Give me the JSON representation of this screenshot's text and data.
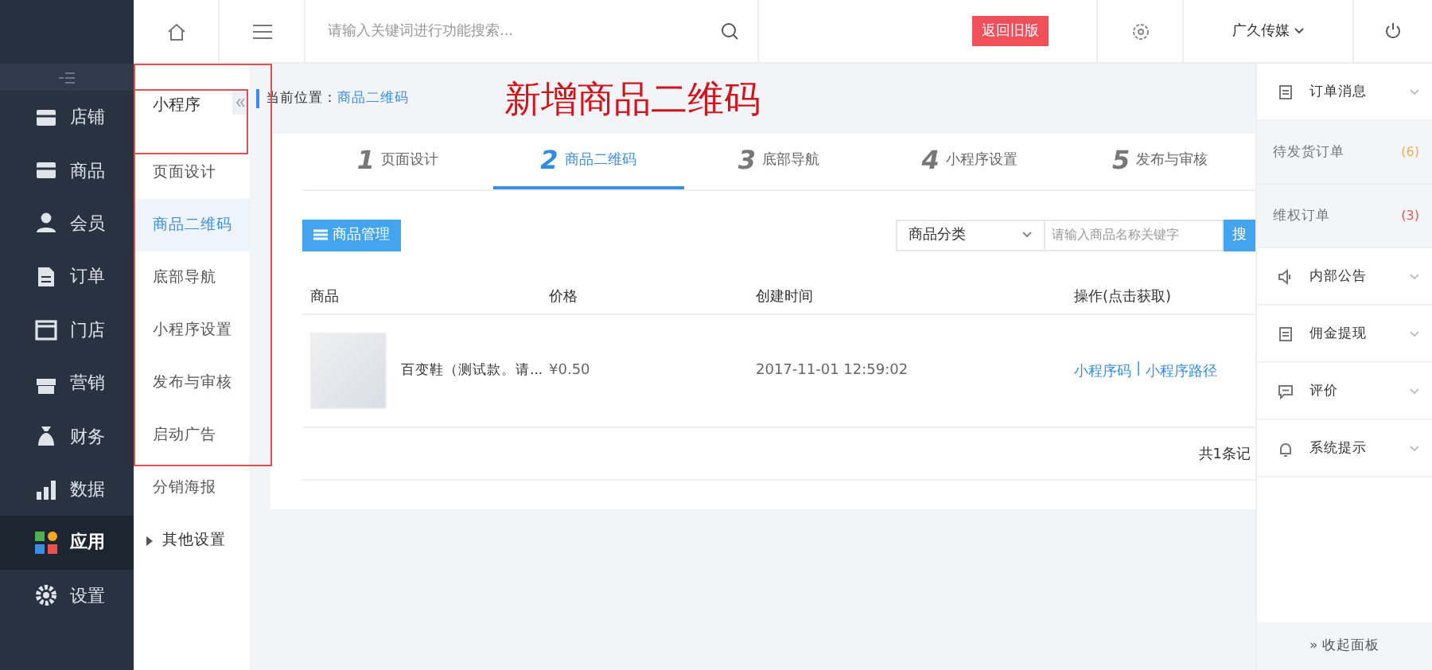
{
  "topbar": {
    "search": {
      "placeholder": "请输入关键词进行功能搜索..."
    },
    "old_version": "返回旧版",
    "account": "广久传媒"
  },
  "sidebar": {
    "items": [
      {
        "label": "店铺",
        "selected": false
      },
      {
        "label": "商品",
        "selected": false
      },
      {
        "label": "会员",
        "selected": false
      },
      {
        "label": "订单",
        "selected": false
      },
      {
        "label": "门店",
        "selected": false
      },
      {
        "label": "营销",
        "selected": false
      },
      {
        "label": "财务",
        "selected": false
      },
      {
        "label": "数据",
        "selected": false
      },
      {
        "label": "应用",
        "selected": true
      },
      {
        "label": "设置",
        "selected": false
      }
    ]
  },
  "subnav": {
    "title": "小程序",
    "items": [
      {
        "label": "页面设计",
        "kind": "link",
        "selected": false
      },
      {
        "label": "商品二维码",
        "kind": "link",
        "selected": true
      },
      {
        "label": "底部导航",
        "kind": "link",
        "selected": false
      },
      {
        "label": "小程序设置",
        "kind": "link",
        "selected": false
      },
      {
        "label": "发布与审核",
        "kind": "link",
        "selected": false
      },
      {
        "label": "启动广告",
        "kind": "link",
        "selected": false
      },
      {
        "label": "分销海报",
        "kind": "link",
        "selected": false
      },
      {
        "label": "其他设置",
        "kind": "group",
        "selected": false
      }
    ]
  },
  "annotation": "新增商品二维码",
  "breadcrumb": {
    "label": "当前位置：",
    "current": "商品二维码"
  },
  "steps": [
    {
      "number": "1",
      "label": "页面设计",
      "selected": false
    },
    {
      "number": "2",
      "label": "商品二维码",
      "selected": true
    },
    {
      "number": "3",
      "label": "底部导航",
      "selected": false
    },
    {
      "number": "4",
      "label": "小程序设置",
      "selected": false
    },
    {
      "number": "5",
      "label": "发布与审核",
      "selected": false
    }
  ],
  "toolbar": {
    "manage_button": "商品管理",
    "category_select": "商品分类",
    "search": {
      "placeholder": "请输入商品名称关键字"
    },
    "search_button": "搜"
  },
  "table": {
    "columns": [
      "商品",
      "价格",
      "创建时间",
      "操作(点击获取)"
    ],
    "rows": [
      {
        "name": "百变鞋（测试款。请...",
        "price": "¥0.50",
        "created": "2017-11-01 12:59:02",
        "actions": [
          "小程序码",
          "小程序路径"
        ],
        "separator": "|"
      }
    ]
  },
  "pagination": "共1条记",
  "right_panel": {
    "sections": [
      {
        "label": "订单消息",
        "children": [
          {
            "label": "待发货订单",
            "count": "(6)",
            "color": "#f0ad4e"
          },
          {
            "label": "维权订单",
            "count": "(3)",
            "color": "#e8534f"
          }
        ]
      },
      {
        "label": "内部公告"
      },
      {
        "label": "佣金提现"
      },
      {
        "label": "评价"
      },
      {
        "label": "系统提示"
      }
    ],
    "collapse": "» 收起面板"
  }
}
